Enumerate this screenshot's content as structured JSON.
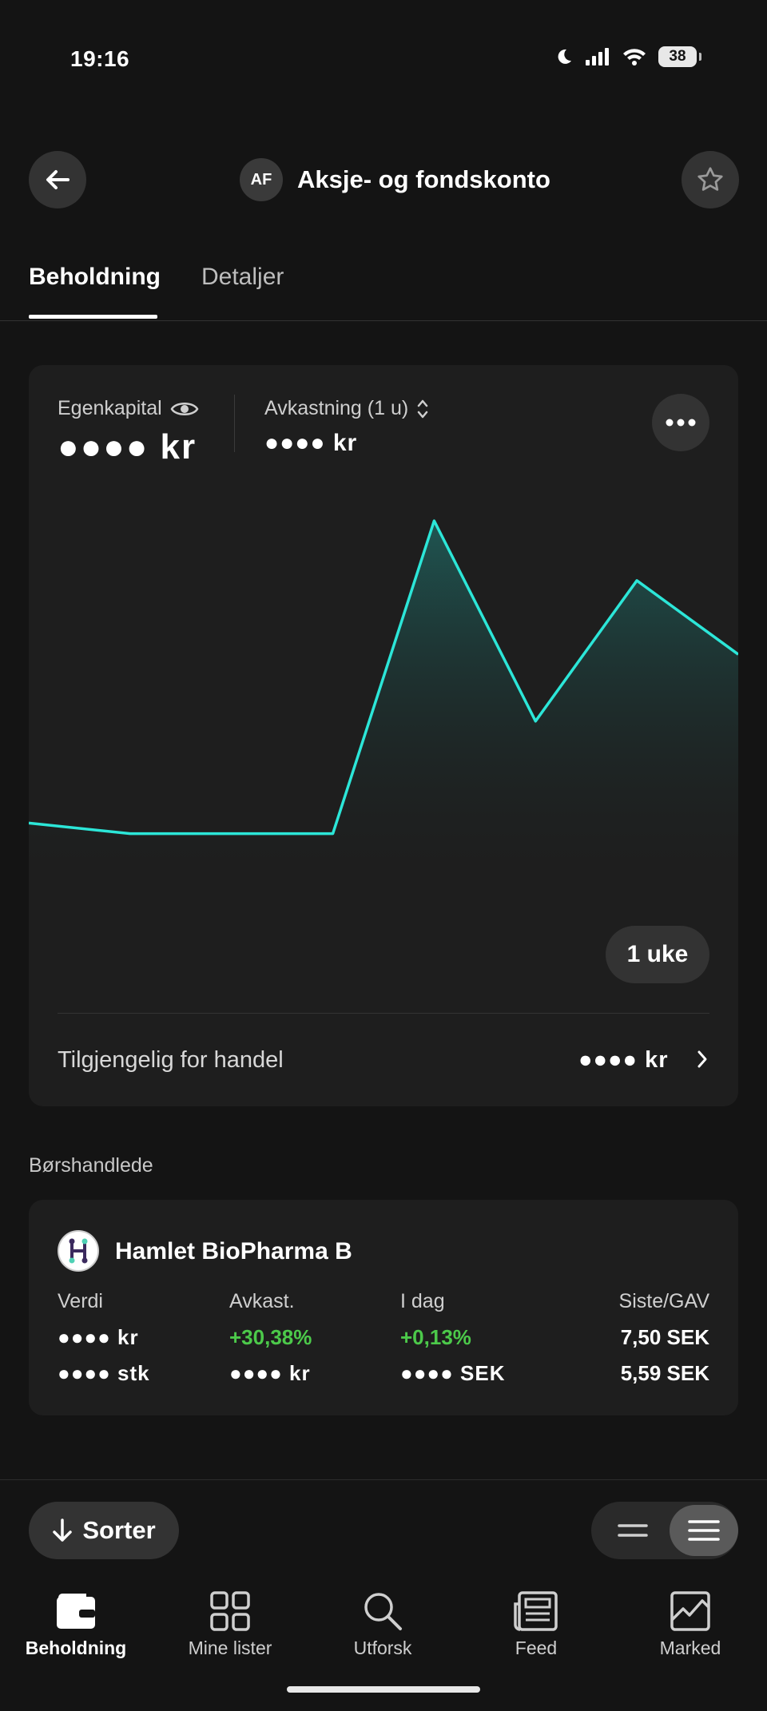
{
  "status_bar": {
    "time": "19:16",
    "battery": "38"
  },
  "header": {
    "account_initials": "AF",
    "title": "Aksje- og fondskonto"
  },
  "tabs": [
    {
      "label": "Beholdning",
      "active": true
    },
    {
      "label": "Detaljer",
      "active": false
    }
  ],
  "summary": {
    "equity_label": "Egenkapital",
    "equity_value": "●●●● kr",
    "return_label": "Avkastning (1 u)",
    "return_value": "●●●● kr",
    "period": "1 uke",
    "available_label": "Tilgjengelig for handel",
    "available_value": "●●●● kr"
  },
  "chart_data": {
    "type": "area",
    "title": "",
    "xlabel": "",
    "ylabel": "",
    "series": [
      {
        "values": [
          0.14,
          0.11,
          0.11,
          0.11,
          1.0,
          0.43,
          0.83,
          0.62
        ]
      }
    ],
    "grid": false,
    "legend": "none",
    "line_color": "#2ce6d8"
  },
  "section_title": "Børshandlede",
  "holding": {
    "name": "Hamlet BioPharma B",
    "columns": [
      "Verdi",
      "Avkast.",
      "I dag",
      "Siste/GAV"
    ],
    "row1": [
      "●●●● kr",
      "+30,38%",
      "+0,13%",
      "7,50 SEK"
    ],
    "row2": [
      "●●●● stk",
      "●●●● kr",
      "●●●● SEK",
      "5,59 SEK"
    ]
  },
  "toolbar": {
    "sort_label": "Sorter"
  },
  "nav": [
    {
      "label": "Beholdning",
      "icon": "wallet-icon",
      "active": true
    },
    {
      "label": "Mine lister",
      "icon": "grid-icon",
      "active": false
    },
    {
      "label": "Utforsk",
      "icon": "search-icon",
      "active": false
    },
    {
      "label": "Feed",
      "icon": "newspaper-icon",
      "active": false
    },
    {
      "label": "Marked",
      "icon": "market-chart-icon",
      "active": false
    }
  ]
}
